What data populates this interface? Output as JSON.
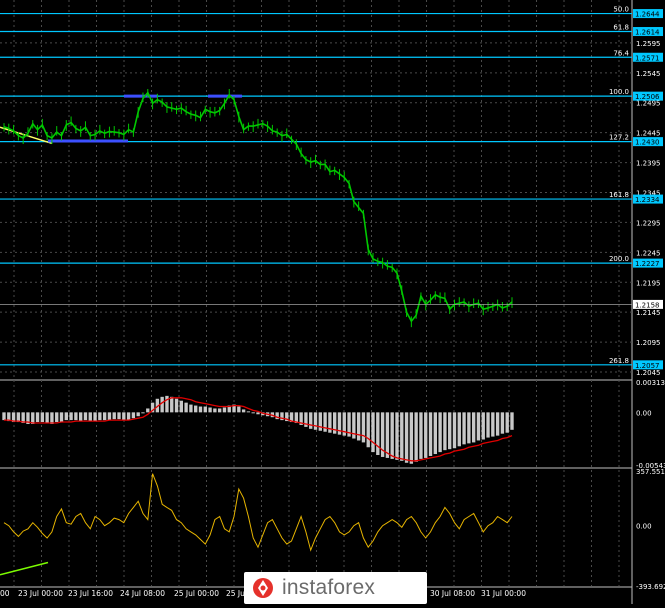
{
  "chart_data": [
    {
      "type": "line",
      "style": "candlestick-like price line",
      "ylim": [
        1.2035,
        1.266
      ],
      "y_ticks": [
        "1.2595",
        "1.2545",
        "1.2495",
        "1.2445",
        "1.2395",
        "1.2345",
        "1.2295",
        "1.2245",
        "1.2195",
        "1.2145",
        "1.2095",
        "1.2045"
      ],
      "current_price": "1.2158",
      "fib_levels": [
        {
          "name": "50.0",
          "tag": "1.2644"
        },
        {
          "name": "61.8",
          "tag": "1.2614"
        },
        {
          "name": "76.4",
          "tag": "1.2571"
        },
        {
          "name": "100.0",
          "tag": "1.2506"
        },
        {
          "name": "127.2",
          "tag": "1.2430"
        },
        {
          "name": "161.8",
          "tag": "1.2334"
        },
        {
          "name": "200.0",
          "tag": "1.2227"
        },
        {
          "name": "261.8",
          "tag": "1.2057"
        }
      ],
      "colors": {
        "price": "#00c800",
        "fib": "#00c8ff",
        "marker": "#3c50ff",
        "trendline": "#ffff66"
      },
      "price": [
        1.2455,
        1.2452,
        1.2448,
        1.244,
        1.2436,
        1.2444,
        1.246,
        1.245,
        1.2458,
        1.244,
        1.2436,
        1.2446,
        1.244,
        1.2458,
        1.2462,
        1.2452,
        1.2448,
        1.2454,
        1.244,
        1.2442,
        1.2448,
        1.2444,
        1.2447,
        1.2446,
        1.2445,
        1.2442,
        1.245,
        1.2446,
        1.248,
        1.2502,
        1.2512,
        1.2494,
        1.25,
        1.2496,
        1.2488,
        1.2486,
        1.2484,
        1.2486,
        1.248,
        1.2476,
        1.2474,
        1.247,
        1.2484,
        1.248,
        1.2478,
        1.2482,
        1.2494,
        1.2508,
        1.25,
        1.2472,
        1.245,
        1.2456,
        1.2456,
        1.2458,
        1.246,
        1.2456,
        1.2448,
        1.2446,
        1.244,
        1.2442,
        1.2434,
        1.2426,
        1.241,
        1.24,
        1.2396,
        1.2398,
        1.2392,
        1.2392,
        1.238,
        1.2382,
        1.2376,
        1.237,
        1.236,
        1.233,
        1.232,
        1.231,
        1.225,
        1.2234,
        1.223,
        1.2228,
        1.2222,
        1.222,
        1.221,
        1.218,
        1.2145,
        1.213,
        1.214,
        1.2172,
        1.2158,
        1.2165,
        1.2174,
        1.217,
        1.2168,
        1.215,
        1.2158,
        1.216,
        1.2162,
        1.2155,
        1.2158,
        1.216,
        1.215,
        1.2152,
        1.2155,
        1.2158,
        1.2152,
        1.2155,
        1.2162
      ]
    },
    {
      "type": "bar",
      "name": "MACD",
      "ylim": [
        -0.00543,
        0.00313
      ],
      "y_ticks": [
        "0.00313",
        "0.00",
        "-0.00543"
      ],
      "colors": {
        "bars": "#c8c8c8",
        "signal": "#e00000"
      },
      "values": [
        -0.0008,
        -0.0009,
        -0.001,
        -0.001,
        -0.0011,
        -0.0012,
        -0.0012,
        -0.001,
        -0.001,
        -0.0011,
        -0.0012,
        -0.001,
        -0.001,
        -0.0008,
        -0.0008,
        -0.0008,
        -0.0009,
        -0.0008,
        -0.0009,
        -0.0009,
        -0.0008,
        -0.0008,
        -0.0008,
        -0.0007,
        -0.0007,
        -0.0008,
        -0.0008,
        -0.0006,
        -0.0004,
        -0.0001,
        0.0004,
        0.001,
        0.0014,
        0.0016,
        0.0017,
        0.0016,
        0.0014,
        0.0012,
        0.001,
        0.0008,
        0.0007,
        0.0006,
        0.0006,
        0.0005,
        0.0004,
        0.0004,
        0.0005,
        0.0007,
        0.0008,
        0.0006,
        0.0003,
        0.0001,
        -0.0001,
        -0.0002,
        -0.0003,
        -0.0004,
        -0.0005,
        -0.0007,
        -0.0008,
        -0.0009,
        -0.001,
        -0.0011,
        -0.0013,
        -0.0015,
        -0.0017,
        -0.0018,
        -0.0019,
        -0.002,
        -0.0021,
        -0.0022,
        -0.0023,
        -0.0024,
        -0.0025,
        -0.0027,
        -0.0029,
        -0.0031,
        -0.0036,
        -0.0041,
        -0.0044,
        -0.0046,
        -0.0047,
        -0.0048,
        -0.0049,
        -0.005,
        -0.0052,
        -0.0053,
        -0.0051,
        -0.0048,
        -0.0047,
        -0.0045,
        -0.0043,
        -0.0041,
        -0.0039,
        -0.0038,
        -0.0037,
        -0.0035,
        -0.0033,
        -0.0032,
        -0.0031,
        -0.0029,
        -0.0028,
        -0.0026,
        -0.0025,
        -0.0024,
        -0.0022,
        -0.0021,
        -0.0018
      ],
      "signal": [
        -0.0008,
        -0.0008,
        -0.0009,
        -0.0009,
        -0.001,
        -0.001,
        -0.0011,
        -0.0011,
        -0.0011,
        -0.0011,
        -0.0011,
        -0.0011,
        -0.001,
        -0.001,
        -0.001,
        -0.0009,
        -0.0009,
        -0.0009,
        -0.0009,
        -0.0009,
        -0.0009,
        -0.0009,
        -0.0008,
        -0.0008,
        -0.0008,
        -0.0008,
        -0.0008,
        -0.0007,
        -0.0006,
        -0.0005,
        -0.0002,
        0.0002,
        0.0006,
        0.001,
        0.0013,
        0.0015,
        0.0015,
        0.0015,
        0.0014,
        0.0013,
        0.0011,
        0.001,
        0.0009,
        0.0008,
        0.0007,
        0.0006,
        0.0006,
        0.0006,
        0.0007,
        0.0007,
        0.0006,
        0.0004,
        0.0002,
        0.0001,
        -0.0001,
        -0.0002,
        -0.0003,
        -0.0005,
        -0.0006,
        -0.0007,
        -0.0009,
        -0.001,
        -0.0011,
        -0.0012,
        -0.0013,
        -0.0014,
        -0.0015,
        -0.0016,
        -0.0017,
        -0.0018,
        -0.0019,
        -0.002,
        -0.0021,
        -0.0022,
        -0.0023,
        -0.0024,
        -0.0027,
        -0.0031,
        -0.0035,
        -0.0039,
        -0.0042,
        -0.0045,
        -0.0047,
        -0.0048,
        -0.0049,
        -0.005,
        -0.005,
        -0.0049,
        -0.0048,
        -0.0047,
        -0.0046,
        -0.0045,
        -0.0043,
        -0.0042,
        -0.004,
        -0.0039,
        -0.0038,
        -0.0036,
        -0.0035,
        -0.0034,
        -0.0032,
        -0.0031,
        -0.003,
        -0.0029,
        -0.0027,
        -0.0026,
        -0.0024
      ]
    },
    {
      "type": "line",
      "name": "CCI",
      "ylim": [
        -393.6923,
        357.5517
      ],
      "y_ticks": [
        "357.5517",
        "0.00",
        "-393.6923"
      ],
      "colors": {
        "line": "#e6b400",
        "trendline": "#7cfc00"
      },
      "values": [
        20,
        0,
        -40,
        -70,
        -35,
        -20,
        20,
        -10,
        -50,
        -80,
        -40,
        60,
        110,
        20,
        10,
        60,
        80,
        20,
        -20,
        60,
        40,
        0,
        20,
        50,
        40,
        20,
        80,
        120,
        160,
        80,
        40,
        340,
        260,
        140,
        120,
        100,
        40,
        20,
        -20,
        -40,
        -60,
        -90,
        -120,
        -60,
        40,
        60,
        -20,
        -40,
        60,
        240,
        180,
        60,
        -80,
        -140,
        -60,
        20,
        40,
        -20,
        -80,
        -120,
        -100,
        -20,
        60,
        -40,
        -160,
        -80,
        -20,
        40,
        60,
        20,
        -40,
        -60,
        -40,
        0,
        20,
        -80,
        -140,
        -100,
        -40,
        0,
        20,
        40,
        20,
        -10,
        40,
        60,
        20,
        -40,
        -80,
        -40,
        20,
        60,
        120,
        80,
        20,
        -20,
        40,
        60,
        80,
        20,
        -40,
        0,
        20,
        60,
        40,
        20,
        60
      ],
      "trendline_value_range": [
        -320,
        -240
      ]
    }
  ],
  "time_labels": [
    "00",
    "23 Jul 00:00",
    "23 Jul 16:00",
    "24 Jul 08:00",
    "25 Jul 00:00",
    "25 Jul",
    "30 Jul 08:00",
    "31 Jul 00:00"
  ],
  "watermark": {
    "brand": "instaforex",
    "icon": "instaforex-logo-icon"
  }
}
